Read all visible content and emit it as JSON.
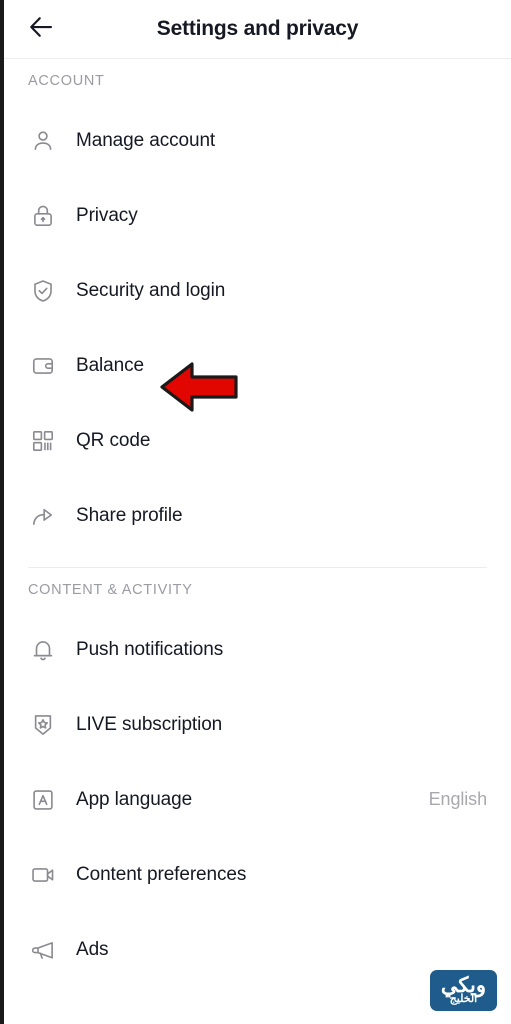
{
  "header": {
    "title": "Settings and privacy",
    "back_icon": "arrow-left-icon"
  },
  "sections": [
    {
      "title": "ACCOUNT",
      "items": [
        {
          "label": "Manage account",
          "icon": "person-icon",
          "value": ""
        },
        {
          "label": "Privacy",
          "icon": "lock-icon",
          "value": ""
        },
        {
          "label": "Security and login",
          "icon": "shield-check-icon",
          "value": ""
        },
        {
          "label": "Balance",
          "icon": "wallet-icon",
          "value": ""
        },
        {
          "label": "QR code",
          "icon": "qr-code-icon",
          "value": ""
        },
        {
          "label": "Share profile",
          "icon": "share-arrow-icon",
          "value": ""
        }
      ]
    },
    {
      "title": "CONTENT & ACTIVITY",
      "items": [
        {
          "label": "Push notifications",
          "icon": "bell-icon",
          "value": ""
        },
        {
          "label": "LIVE subscription",
          "icon": "badge-star-icon",
          "value": ""
        },
        {
          "label": "App language",
          "icon": "letter-a-box-icon",
          "value": "English"
        },
        {
          "label": "Content preferences",
          "icon": "video-camera-icon",
          "value": ""
        },
        {
          "label": "Ads",
          "icon": "megaphone-icon",
          "value": ""
        }
      ]
    }
  ],
  "annotation": {
    "type": "arrow-left",
    "points_to": "Balance",
    "fill_color": "#E10600",
    "stroke_color": "#1a1a1a"
  },
  "watermark": {
    "main_text": "ويكي",
    "sub_text": "الخليج",
    "background_color": "#1F5C8B"
  },
  "colors": {
    "text_primary": "#161823",
    "text_muted": "#9b9ba3",
    "icon_gray": "#8a8a91",
    "divider": "#ededed",
    "background": "#ffffff"
  }
}
